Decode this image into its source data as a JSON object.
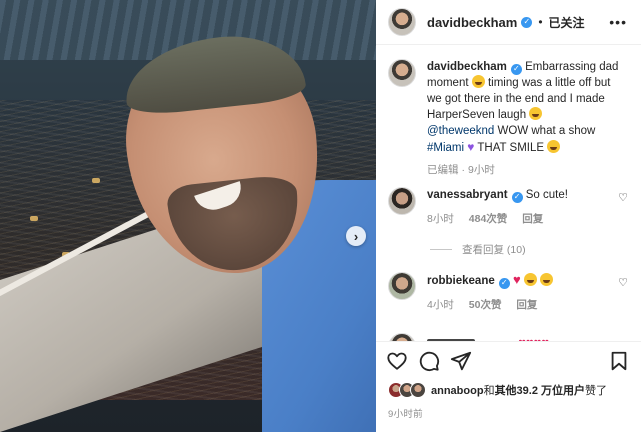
{
  "media": {
    "carousel_next_glyph": "›"
  },
  "header": {
    "username": "davidbeckham",
    "separator": "•",
    "follow_state": "已关注",
    "more_glyph": "•••"
  },
  "caption": {
    "username": "davidbeckham",
    "text_1": "Embarrassing dad moment",
    "text_2": "timing was a little off but we got there in the end and I made HarperSeven laugh",
    "mention": "@theweeknd",
    "text_3": "WOW what a show",
    "hashtag": "#Miami",
    "text_4": "THAT SMILE",
    "edited": "已编辑",
    "dot": "·",
    "time": "9小时"
  },
  "comments": [
    {
      "username": "vanessabryant",
      "text": "So cute!",
      "time": "8小时",
      "likes": "484次赞",
      "reply": "回复",
      "view_replies": "查看回复 (10)"
    },
    {
      "username": "robbiekeane",
      "time": "4小时",
      "likes": "50次赞",
      "reply": "回复"
    }
  ],
  "likes": {
    "user": "annaboop",
    "connector": "和",
    "others": "其他39.2 万位用户",
    "suffix": "赞了"
  },
  "post_time": "9小时前",
  "colors": {
    "verified": "#3897f0",
    "link": "#00376b",
    "muted": "#8e8e8e",
    "shirt": "#4a7fc7"
  }
}
